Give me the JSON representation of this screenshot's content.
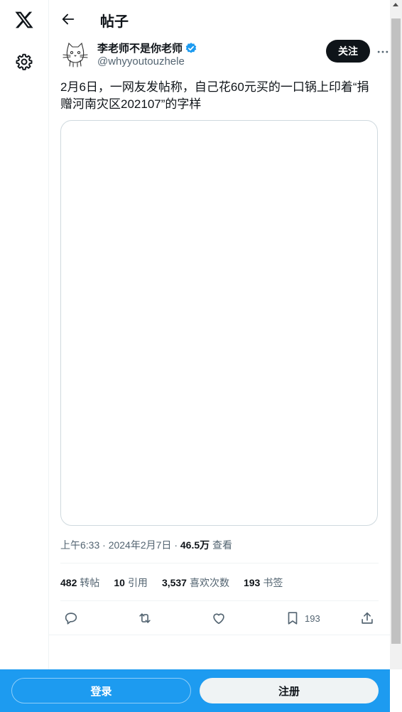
{
  "header": {
    "title": "帖子"
  },
  "author": {
    "name": "李老师不是你老师",
    "handle": "@whyyoutouzhele",
    "follow_label": "关注"
  },
  "tweet": {
    "text": "2月6日，一网友发帖称，自己花60元买的一口锅上印着“捐赠河南灾区202107”的字样",
    "time": "上午6:33",
    "date": "2024年2月7日",
    "sep": "·",
    "views": "46.5万",
    "views_label": "查看"
  },
  "stats": {
    "reposts": "482",
    "reposts_label": "转帖",
    "quotes": "10",
    "quotes_label": "引用",
    "likes": "3,537",
    "likes_label": "喜欢次数",
    "bookmarks": "193",
    "bookmarks_label": "书签"
  },
  "actions": {
    "bookmark_count": "193"
  },
  "bottom_bar": {
    "login_label": "登录",
    "signup_label": "注册"
  },
  "colors": {
    "accent": "#1d9bf0",
    "verified": "#1d9bf0",
    "text": "#0f1419",
    "muted": "#536471"
  },
  "icons": [
    "x-logo-icon",
    "gear-icon",
    "back-arrow-icon",
    "verified-badge-icon",
    "more-icon",
    "reply-icon",
    "repost-icon",
    "like-icon",
    "bookmark-icon",
    "share-icon"
  ]
}
